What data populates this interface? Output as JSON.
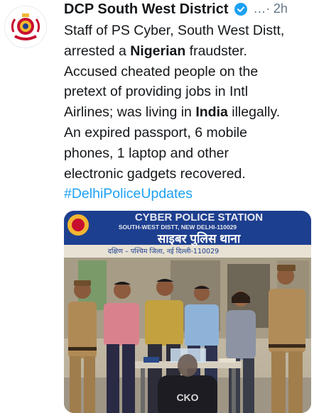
{
  "header": {
    "display_name": "DCP South West District",
    "more_glyph": "…·",
    "time": "2h"
  },
  "tweet": {
    "lines": [
      [
        "Staff of PS Cyber, South West Distt,"
      ],
      [
        "arrested a ",
        "Nigerian",
        " fraudster."
      ],
      [
        "Accused cheated people on the"
      ],
      [
        "pretext of providing jobs in Intl"
      ],
      [
        "Airlines; was living in ",
        "India",
        " illegally."
      ],
      [
        "An expired passport, 6 mobile"
      ],
      [
        "phones, 1 laptop and other"
      ],
      [
        "electronic gadgets recovered."
      ]
    ],
    "hashtag": "#DelhiPoliceUpdates"
  },
  "photo": {
    "banner_line1": "CYBER POLICE STATION",
    "banner_line2": "SOUTH-WEST DISTT, NEW DELHI-110029",
    "banner_line3": "साइबर पुलिस थाना",
    "banner_line4": "दक्षिण – पश्चिम जिला, नई दिल्ली-110029",
    "shirt_text": "CKO"
  },
  "colors": {
    "link": "#1da1f2",
    "verified": "#1da1f2",
    "banner": "#1d3f8f"
  }
}
